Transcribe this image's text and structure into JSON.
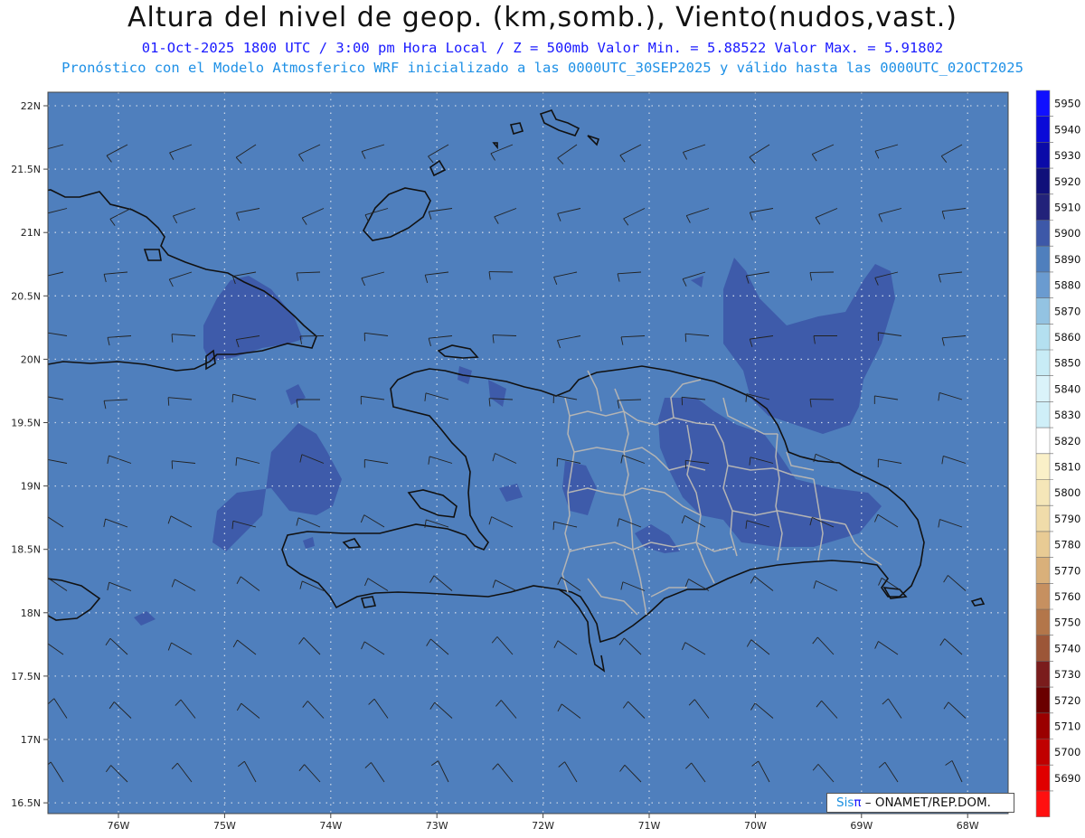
{
  "header": {
    "title": "Altura del nivel de geop. (km,somb.), Viento(nudos,vast.)",
    "line1": "01-Oct-2025  1800 UTC / 3:00 pm Hora Local / Z = 500mb     Valor Min. = 5.88522  Valor Max. = 5.91802",
    "line2": "Pronóstico con el Modelo Atmosferico WRF inicializado a las 0000UTC_30SEP2025 y válido hasta las  0000UTC_02OCT2025"
  },
  "map": {
    "background_color": "#4f7fbd",
    "high_color": "#3d58a8",
    "land_outline_color": "#111111",
    "province_color": "#b4b4b4",
    "lat_labels": [
      "22N",
      "21.5N",
      "21N",
      "20.5N",
      "20N",
      "19.5N",
      "19N",
      "18.5N",
      "18N",
      "17.5N",
      "17N",
      "16.5N"
    ],
    "lon_labels": [
      "76W",
      "75W",
      "74W",
      "73W",
      "72W",
      "71W",
      "70W",
      "69W",
      "68W"
    ]
  },
  "colorbar": {
    "levels": [
      "5950",
      "5940",
      "5930",
      "5920",
      "5910",
      "5900",
      "5890",
      "5880",
      "5870",
      "5860",
      "5850",
      "5840",
      "5830",
      "5820",
      "5810",
      "5800",
      "5790",
      "5780",
      "5770",
      "5760",
      "5750",
      "5740",
      "5730",
      "5720",
      "5710",
      "5700",
      "5690"
    ],
    "colors": [
      "#1010ff",
      "#0a0ad8",
      "#0a0aa8",
      "#10107a",
      "#22227a",
      "#3d58a8",
      "#4f7fbd",
      "#6a9bd0",
      "#93c3e2",
      "#b4e0f0",
      "#c8ecf6",
      "#daf3fa",
      "#cfeff8",
      "#ffffff",
      "#faf0c8",
      "#f5e6b8",
      "#f0dcaa",
      "#e8cb94",
      "#d9b07a",
      "#c69060",
      "#b3764a",
      "#9c5638",
      "#7a1c1c",
      "#6a0000",
      "#9a0000",
      "#c00000",
      "#e00000",
      "#ff1010"
    ]
  },
  "credit": {
    "sis": "Sis",
    "pi": "π",
    "rest": " – ONAMET/REP.DOM."
  }
}
